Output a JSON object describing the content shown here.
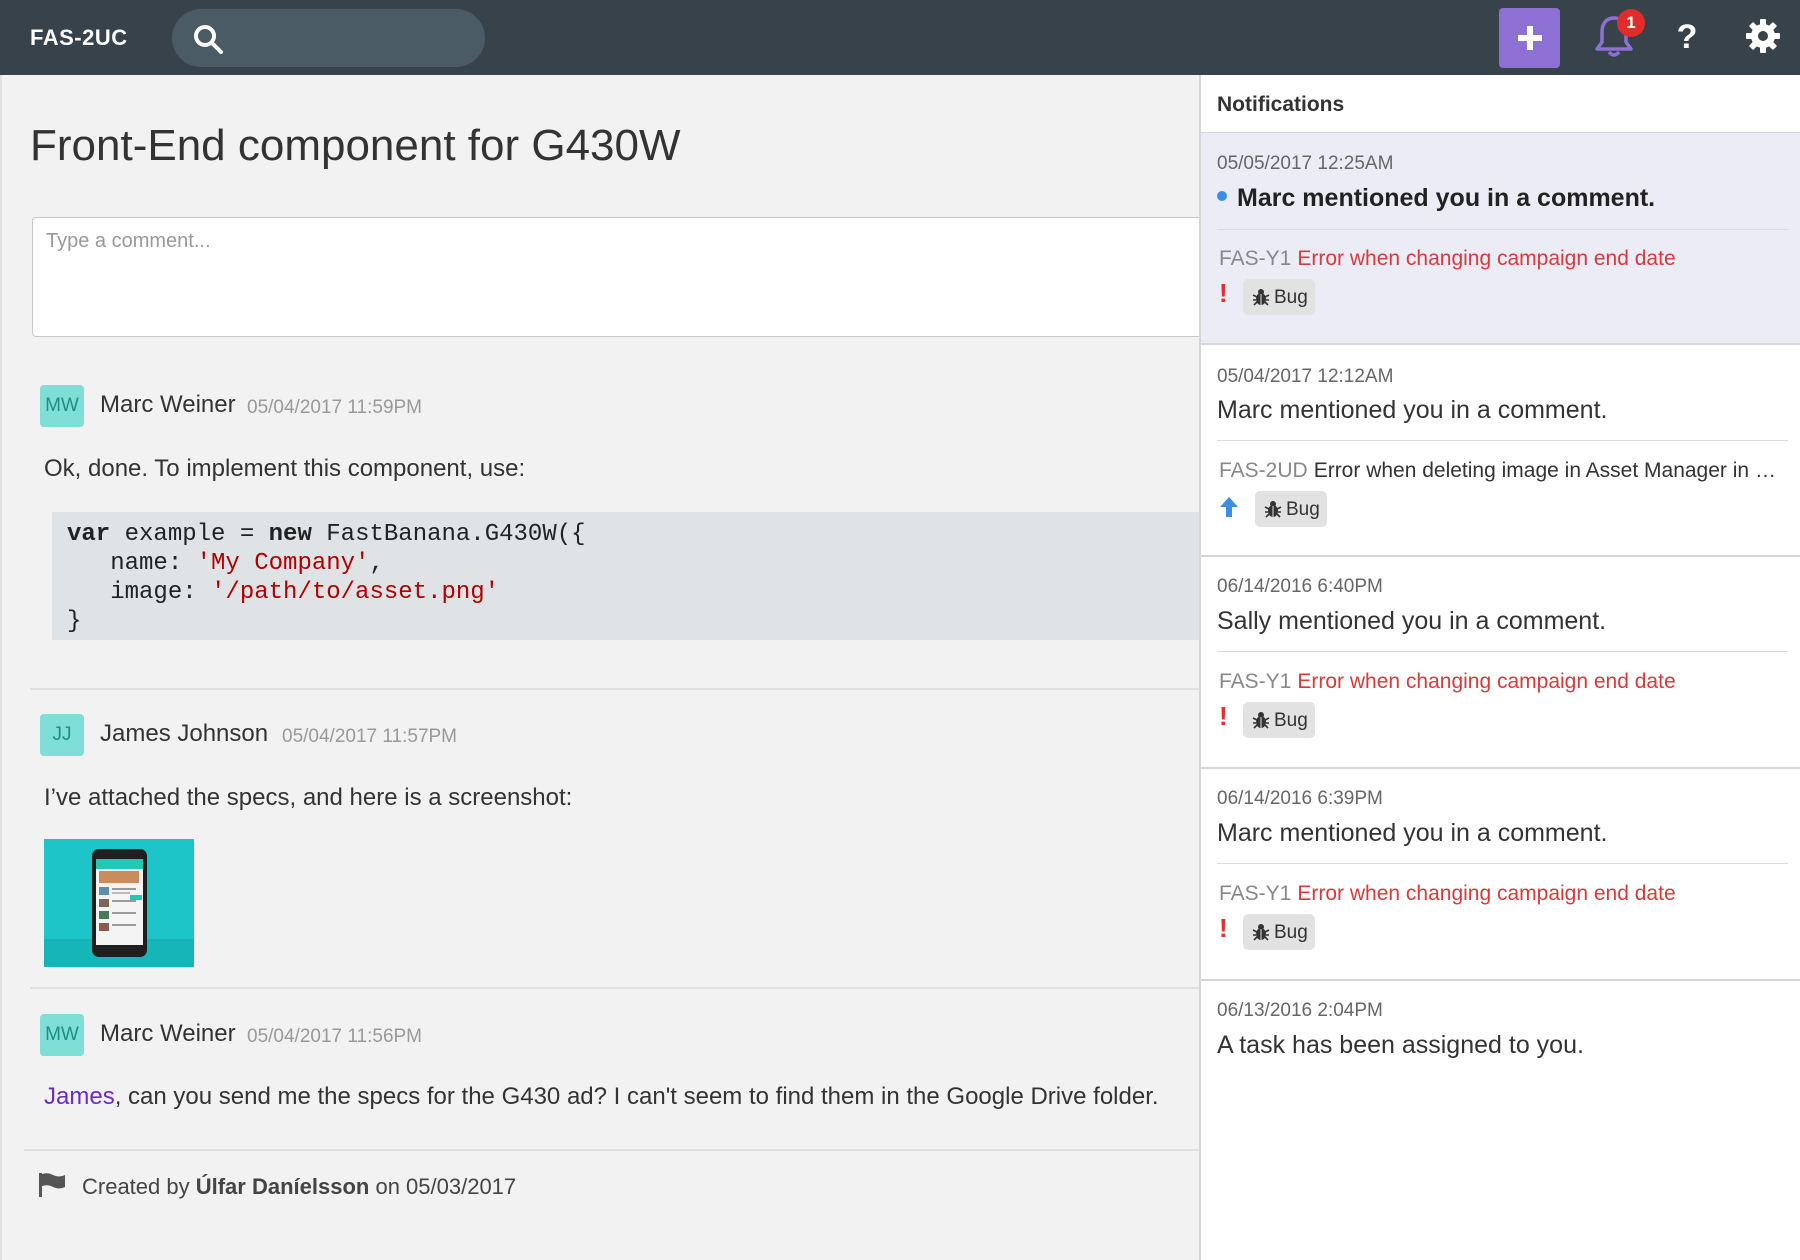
{
  "topbar": {
    "brand": "FAS-2UC",
    "notification_count": "1",
    "help_label": "?",
    "colors": {
      "bar": "#37424a",
      "add_button": "#8e6fd4",
      "badge": "#e22c2c"
    }
  },
  "main": {
    "title": "Front-End component for G430W",
    "comment_placeholder": "Type a comment...",
    "comments": [
      {
        "initials": "MW",
        "author": "Marc Weiner",
        "timestamp": "05/04/2017 11:59PM",
        "text": "Ok, done. To implement this component, use:",
        "code": {
          "kw1": "var",
          "l1a": " example = ",
          "kw2": "new",
          "l1b": " FastBanana.G430W({",
          "l2a": "   name: ",
          "l2s": "'My Company'",
          "l2b": ",",
          "l3a": "   image: ",
          "l3s": "'/path/to/asset.png'",
          "l4": "}"
        }
      },
      {
        "initials": "JJ",
        "author": "James Johnson",
        "timestamp": "05/04/2017 11:57PM",
        "text": "I’ve attached the specs, and here is a screenshot:"
      },
      {
        "initials": "MW",
        "author": "Marc Weiner",
        "timestamp": "05/04/2017 11:56PM",
        "mention": "James",
        "text": ", can you send me the specs for the G430 ad? I can't seem to find them in the Google Drive folder."
      }
    ],
    "footer": {
      "prefix": "Created by ",
      "creator": "Úlfar Daníelsson",
      "suffix": " on 05/03/2017"
    }
  },
  "notifications": {
    "title": "Notifications",
    "items": [
      {
        "date": "05/05/2017 12:25AM",
        "message": "Marc mentioned you in a comment.",
        "unread": true,
        "task_key": "FAS-Y1",
        "task_title": "Error when changing campaign end date",
        "priority": "!",
        "tag": "Bug"
      },
      {
        "date": "05/04/2017 12:12AM",
        "message": "Marc mentioned you in a comment.",
        "task_key": "FAS-2UD",
        "task_title": "Error when deleting image in Asset Manager in Firefox",
        "priority": "up",
        "tag": "Bug"
      },
      {
        "date": "06/14/2016 6:40PM",
        "message": "Sally mentioned you in a comment.",
        "task_key": "FAS-Y1",
        "task_title": "Error when changing campaign end date",
        "priority": "!",
        "tag": "Bug"
      },
      {
        "date": "06/14/2016 6:39PM",
        "message": "Marc mentioned you in a comment.",
        "task_key": "FAS-Y1",
        "task_title": "Error when changing campaign end date",
        "priority": "!",
        "tag": "Bug"
      },
      {
        "date": "06/13/2016 2:04PM",
        "message": "A task has been assigned to you."
      }
    ]
  }
}
